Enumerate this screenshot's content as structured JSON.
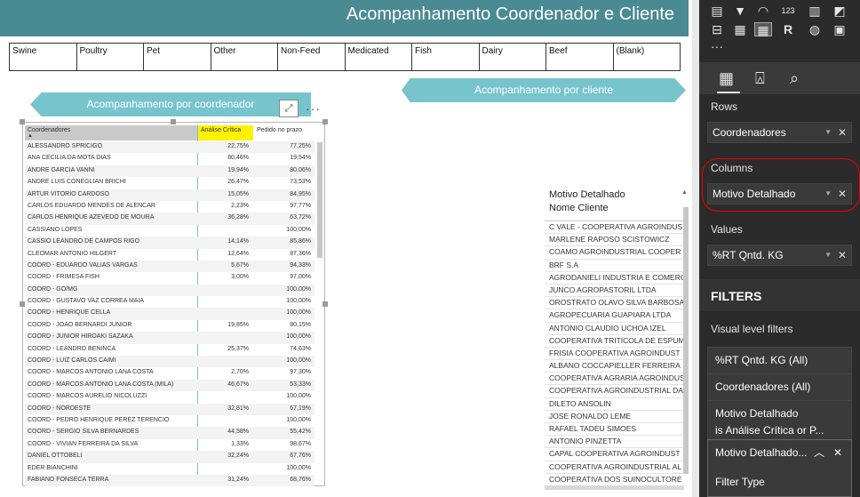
{
  "header": {
    "title": "Acompanhamento Coordenador e Cliente"
  },
  "slicer": {
    "items": [
      "Swine",
      "Poultry",
      "Pet",
      "Other",
      "Non-Feed",
      "Medicated",
      "Fish",
      "Dairy",
      "Beef",
      "(Blank)"
    ]
  },
  "banners": {
    "coord": "Acompanhamento por coordenador",
    "client": "Acompanhamento por cliente"
  },
  "matrix": {
    "headers": {
      "col1": "Coordenadores",
      "col2": "Análise Crítica",
      "col3": "Pedido no prazo"
    },
    "rows": [
      {
        "name": "ALESSANDRO SPRICIGO",
        "a": "22,75%",
        "b": "77,25%"
      },
      {
        "name": "ANA CECILIA DA MOTA DIAS",
        "a": "80,46%",
        "b": "19,54%"
      },
      {
        "name": "ANDRE GARCIA VANNI",
        "a": "19,94%",
        "b": "80,06%"
      },
      {
        "name": "ANDRE LUIS CONEGLIAN BRICHI",
        "a": "26,47%",
        "b": "73,53%"
      },
      {
        "name": "ARTUR VITORIO CARDOSO",
        "a": "15,05%",
        "b": "84,95%"
      },
      {
        "name": "CARLOS EDUARDO MENDES DE ALENCAR",
        "a": "2,23%",
        "b": "97,77%"
      },
      {
        "name": "CARLOS HENRIQUE AZEVEDO DE MOURA",
        "a": "36,28%",
        "b": "63,72%"
      },
      {
        "name": "CASSIANO LOPES",
        "a": "",
        "b": "100,00%"
      },
      {
        "name": "CASSIO LEANDRO DE CAMPOS RIGO",
        "a": "14,14%",
        "b": "85,86%"
      },
      {
        "name": "CLEOMAR ANTONIO HILGERT",
        "a": "12,64%",
        "b": "87,36%"
      },
      {
        "name": "COORD - EDUARDO VALIAS VARGAS",
        "a": "5,67%",
        "b": "94,33%"
      },
      {
        "name": "COORD - FRIMESA FISH",
        "a": "3,00%",
        "b": "97,00%"
      },
      {
        "name": "COORD - GO/MG",
        "a": "",
        "b": "100,00%"
      },
      {
        "name": "COORD - GUSTAVO VAZ CORREA MAIA",
        "a": "",
        "b": "100,00%"
      },
      {
        "name": "COORD - HENRIQUE CELLA",
        "a": "",
        "b": "100,00%"
      },
      {
        "name": "COORD - JOAO BERNARDI JUNIOR",
        "a": "19,85%",
        "b": "80,15%"
      },
      {
        "name": "COORD - JUNIOR HIROAKI SAZAKA",
        "a": "",
        "b": "100,00%"
      },
      {
        "name": "COORD - LEANDRO BENINCA",
        "a": "25,37%",
        "b": "74,63%"
      },
      {
        "name": "COORD - LUIZ CARLOS CAIMI",
        "a": "",
        "b": "100,00%"
      },
      {
        "name": "COORD - MARCOS ANTONIO LANA COSTA",
        "a": "2,70%",
        "b": "97,30%"
      },
      {
        "name": "COORD - MARCOS ANTONIO LANA COSTA (MILA)",
        "a": "46,67%",
        "b": "53,33%"
      },
      {
        "name": "COORD - MARCOS AURELIO NICOLUZZI",
        "a": "",
        "b": "100,00%"
      },
      {
        "name": "COORD - NORDESTE",
        "a": "32,81%",
        "b": "67,19%"
      },
      {
        "name": "COORD - PEDRO HENRIQUE PEREZ TERENCIO",
        "a": "",
        "b": "100,00%"
      },
      {
        "name": "COORD - SERGIO SILVA BERNARDES",
        "a": "44,58%",
        "b": "55,42%"
      },
      {
        "name": "COORD - VIVIAN FERREIRA DA SILVA",
        "a": "1,33%",
        "b": "98,67%"
      },
      {
        "name": "DANIEL OTTOBELI",
        "a": "32,24%",
        "b": "67,76%"
      },
      {
        "name": "EDER BIANCHINI",
        "a": "",
        "b": "100,00%"
      },
      {
        "name": "FABIANO FONSECA TERRA",
        "a": "31,24%",
        "b": "68,76%"
      }
    ]
  },
  "client_table": {
    "header1": "Motivo Detalhado",
    "header2": "Nome Cliente",
    "rows": [
      "C VALE - COOPERATIVA AGROINDUS",
      "MARLENE RAPOSO SCISTOWICZ",
      "COAMO AGROINDUSTRIAL COOPER",
      "BRF S.A",
      "AGRODANIELI INDUSTRIA E COMERC",
      "JUNCO AGROPASTORIL LTDA",
      "OROSTRATO OLAVO SILVA BARBOSA",
      "AGROPECUARIA GUAPIARA LTDA",
      "ANTONIO CLAUDIO UCHOA IZEL",
      "COOPERATIVA TRITICOLA DE ESPUM",
      "FRISIA COOPERATIVA AGROINDUST",
      "ALBANO COCCAPIELLER FERREIRA",
      "COOPERATIVA AGRARIA AGROINDUST",
      "COOPERATIVA AGROINDUSTRIAL DA",
      "DILETO ANSOLIN",
      "JOSE RONALDO LEME",
      "RAFAEL TADEU SIMOES",
      "ANTONIO PINZETTA",
      "CAPAL COOPERATIVA AGROINDUST",
      "COOPERATIVA AGROINDUSTRIAL AL",
      "COOPERATIVA DOS SUINOCULTORE"
    ]
  },
  "pane": {
    "rows_label": "Rows",
    "rows_value": "Coordenadores",
    "columns_label": "Columns",
    "columns_value": "Motivo Detalhado",
    "values_label": "Values",
    "values_value": "%RT Qntd. KG",
    "filters_title": "FILTERS",
    "visual_filters_label": "Visual level filters",
    "filter1": "%RT Qntd. KG (All)",
    "filter2": "Coordenadores  (All)",
    "filter3_line1": "Motivo Detalhado",
    "filter3_line2": "is Análise Crítica or P...",
    "filter4": "Motivo Detalhado...",
    "filter_type_label": "Filter Type"
  },
  "icons": [
    "paint-roller-icon",
    "analytics-magnifier-icon",
    "fields-grid-icon",
    "focus-mode-icon",
    "more-options-icon",
    "close-icon",
    "chevron-down-icon",
    "chevron-up-icon",
    "sort-arrow-icon"
  ]
}
